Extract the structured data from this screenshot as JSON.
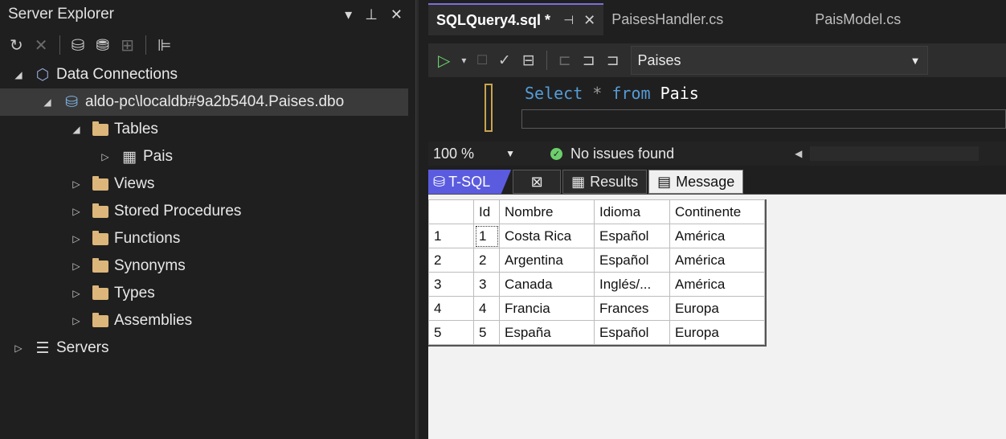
{
  "server_explorer": {
    "title": "Server Explorer",
    "tree": {
      "data_connections": "Data Connections",
      "connection": "aldo-pc\\localdb#9a2b5404.Paises.dbo",
      "tables": "Tables",
      "pais": "Pais",
      "views": "Views",
      "stored_procedures": "Stored Procedures",
      "functions": "Functions",
      "synonyms": "Synonyms",
      "types": "Types",
      "assemblies": "Assemblies",
      "servers": "Servers"
    }
  },
  "editor_tabs": {
    "active": "SQLQuery4.sql *",
    "tab2": "PaisesHandler.cs",
    "tab3": "PaisModel.cs"
  },
  "query_toolbar": {
    "database": "Paises"
  },
  "query": {
    "kw_select": "Select",
    "star": "*",
    "kw_from": "from",
    "table": "Pais"
  },
  "status": {
    "zoom": "100 %",
    "issues": "No issues found"
  },
  "result_tabs": {
    "tsql": "T-SQL",
    "results": "Results",
    "message": "Message"
  },
  "results_grid": {
    "columns": [
      "Id",
      "Nombre",
      "Idioma",
      "Continente"
    ],
    "rows": [
      {
        "n": "1",
        "id": "1",
        "nombre": "Costa Rica",
        "idioma": "Español",
        "continente": "América"
      },
      {
        "n": "2",
        "id": "2",
        "nombre": "Argentina",
        "idioma": "Español",
        "continente": "América"
      },
      {
        "n": "3",
        "id": "3",
        "nombre": "Canada",
        "idioma": "Inglés/...",
        "continente": "América"
      },
      {
        "n": "4",
        "id": "4",
        "nombre": "Francia",
        "idioma": "Frances",
        "continente": "Europa"
      },
      {
        "n": "5",
        "id": "5",
        "nombre": "España",
        "idioma": "Español",
        "continente": "Europa"
      }
    ]
  }
}
